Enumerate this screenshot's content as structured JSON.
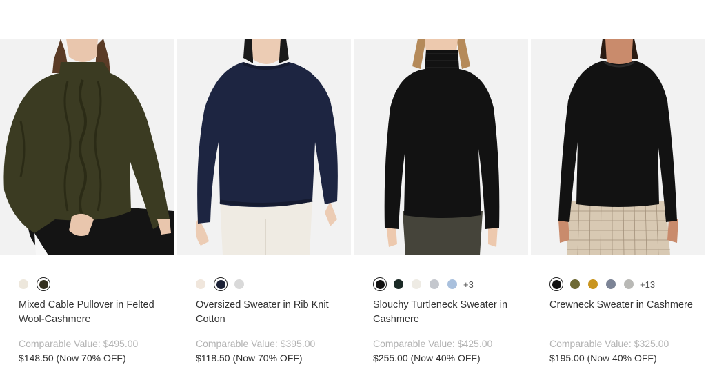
{
  "products": [
    {
      "name": "Mixed Cable Pullover in Felted Wool-Cashmere",
      "comparable_value": "Comparable Value: $495.00",
      "sale_price": "$148.50 (Now 70% OFF)",
      "colors": [
        "#ede7dc",
        "#34301f"
      ],
      "selected_color": 1,
      "more_colors": "",
      "photo": {
        "bg": "#f2f2f2",
        "sweater": "#3b3b22",
        "bottom": "#141414",
        "skin": "#e9c6ad",
        "hair": "#5a3b26"
      }
    },
    {
      "name": "Oversized Sweater in Rib Knit Cotton",
      "comparable_value": "Comparable Value: $395.00",
      "sale_price": "$118.50 (Now 70% OFF)",
      "colors": [
        "#f0e6dc",
        "#1b2136",
        "#d9d9d9"
      ],
      "selected_color": 1,
      "more_colors": "",
      "photo": {
        "bg": "#f2f2f2",
        "sweater": "#1d2541",
        "bottom": "#efebe3",
        "skin": "#ecccb4",
        "hair": "#1a1a1a"
      }
    },
    {
      "name": "Slouchy Turtleneck Sweater in Cashmere",
      "comparable_value": "Comparable Value: $425.00",
      "sale_price": "$255.00 (Now 40% OFF)",
      "colors": [
        "#111111",
        "#1b2a26",
        "#eeebe4",
        "#c4c7cd",
        "#a9c0dd"
      ],
      "selected_color": 0,
      "more_colors": "+3",
      "photo": {
        "bg": "#f2f2f2",
        "sweater": "#121212",
        "bottom": "#45443a",
        "skin": "#edc9ae",
        "hair": "#b58a5a"
      }
    },
    {
      "name": "Crewneck Sweater in Cashmere",
      "comparable_value": "Comparable Value: $325.00",
      "sale_price": "$195.00 (Now 40% OFF)",
      "colors": [
        "#111111",
        "#6e6a35",
        "#c9951f",
        "#7c8496",
        "#b9b9b6"
      ],
      "selected_color": 0,
      "more_colors": "+13",
      "photo": {
        "bg": "#f2f2f2",
        "sweater": "#121212",
        "bottom": "#d8c9b3",
        "skin": "#c98b6c",
        "hair": "#2a1b12"
      }
    }
  ]
}
